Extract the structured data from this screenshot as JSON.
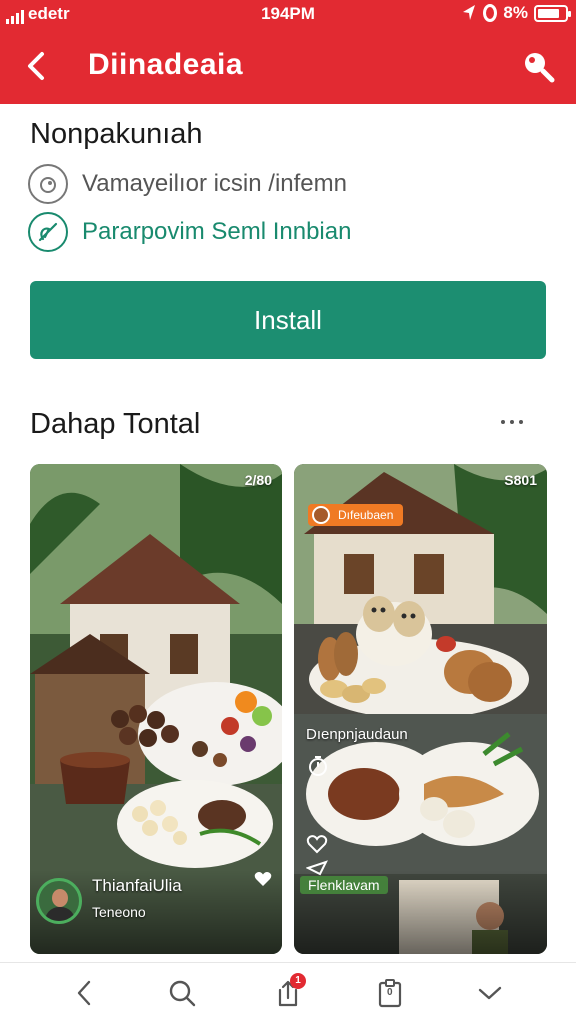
{
  "status_bar": {
    "carrier": "edetr",
    "time": "194PM",
    "battery_text": "8%",
    "battery_level": 0.8,
    "icons": [
      "signal-icon",
      "location-arrow-icon",
      "alarm-icon",
      "battery-icon"
    ]
  },
  "app_bar": {
    "title": "Diinadeaia",
    "back_icon": "back-chevron-icon",
    "search_icon": "search-icon",
    "color": "#e22a32"
  },
  "app": {
    "name": "Nonpakunıah",
    "info_row": "Vamayeilıor icsin /infemn",
    "feature_row": "Pararpovim Seml Innbian",
    "install_label": "Install",
    "install_color": "#1c8e71"
  },
  "section": {
    "title": "Dahap Tontal",
    "more_icon": "more-horizontal-icon"
  },
  "cards": [
    {
      "badge": "2/80",
      "user_name": "ThianfaiUlia",
      "user_sub": "Teneono",
      "favorite_icon": "heart-icon"
    },
    {
      "badge": "S801",
      "chip_label": "Dıfeubaen",
      "caption": "Dıenpnjaudaun",
      "name_chip": "Flenklavam",
      "like_icon": "heart-outline-icon",
      "share_icon": "share-icon"
    }
  ],
  "bottom_nav": {
    "items": [
      "back-icon",
      "search-icon",
      "share-icon",
      "clipboard-icon",
      "check-icon"
    ],
    "badge_count": "1",
    "clipboard_count": "0"
  }
}
